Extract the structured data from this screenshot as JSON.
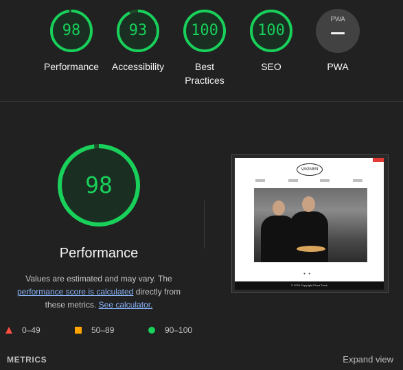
{
  "colors": {
    "pass": "#18d05a",
    "average": "#ffa400",
    "fail": "#ff4e42",
    "link": "#8ab4f8",
    "background": "#212121"
  },
  "scores": [
    {
      "value": "98",
      "label": "Performance",
      "fraction": 0.98
    },
    {
      "value": "93",
      "label": "Accessibility",
      "fraction": 0.93
    },
    {
      "value": "100",
      "label": "Best Practices",
      "fraction": 1.0
    },
    {
      "value": "100",
      "label": "SEO",
      "fraction": 1.0
    }
  ],
  "pwa": {
    "badge_text": "PWA",
    "label": "PWA",
    "icon": "pwa-badge-icon"
  },
  "performance": {
    "score": "98",
    "fraction": 0.98,
    "title": "Performance",
    "desc_prefix": "Values are estimated and may vary. The",
    "desc_link": "performance score is calculated",
    "desc_middle": "directly from these metrics.",
    "desc_link2": "See calculator."
  },
  "screenshot": {
    "logo": "VAGNEN",
    "footer": "© 2020 Copyright Pizza Truck"
  },
  "legend": [
    {
      "range": "0–49",
      "icon": "fail-triangle-icon"
    },
    {
      "range": "50–89",
      "icon": "average-square-icon"
    },
    {
      "range": "90–100",
      "icon": "pass-circle-icon"
    }
  ],
  "metrics": {
    "title": "METRICS",
    "expand_label": "Expand view"
  }
}
